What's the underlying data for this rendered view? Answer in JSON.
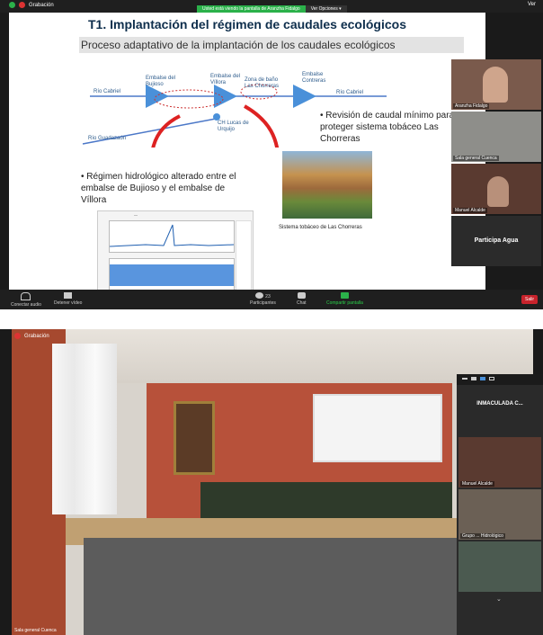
{
  "screenshot1": {
    "recording_label": "Grabación",
    "banner": {
      "sharing_text": "Usted está viendo la pantalla de Aranzha Fidalgo",
      "view_options": "Ver Opciones ▾"
    },
    "view_button": "Ver",
    "slide": {
      "title": "T1. Implantación del régimen de caudales ecológicos",
      "subtitle": "Proceso adaptativo de la implantación de los caudales ecológicos",
      "diagram_labels": {
        "rio_cabriel_left": "Río Cabriel",
        "embalse_bujioso": "Embalse del Bujioso",
        "embalse_villora": "Embalse del Víllora",
        "zona_bano": "Zona de baño Las Chorreras",
        "embalse_contreras": "Embalse Contreras",
        "rio_cabriel_right": "Río Cabriel",
        "rio_guadazaon": "Río Guadazaón",
        "ch_lucas": "CH Lucas de Urquijo"
      },
      "bullet_right": "Revisión de caudal mínimo para proteger sistema tobáceo Las Chorreras",
      "bullet_left": "Régimen hidrológico alterado entre el embalse de Bujioso y el embalse de Víllora",
      "photo_caption": "Sistema tobáceo de Las Chorreras"
    },
    "gallery": [
      {
        "name": "Aranzha Fidalgo"
      },
      {
        "name": "Sala general Cuenca"
      },
      {
        "name": "Manuel Alcalde"
      },
      {
        "big_name": "Participa Agua"
      }
    ],
    "bottombar": {
      "audio_label": "Conectar audio",
      "video_label": "Detener vídeo",
      "participants_label": "Participantes",
      "participants_count": "23",
      "chat_label": "Chat",
      "share_label": "Compartir pantalla",
      "exit_label": "Salir"
    }
  },
  "screenshot2": {
    "recording_label": "Grabación",
    "room_label": "Sala general Cuenca",
    "side_panel": {
      "featured_name": "INMACULADA C...",
      "tiles": [
        {
          "name": "Manuel Alcalde"
        },
        {
          "name": "Grupo ... Hidrológico"
        },
        {
          "name": ""
        }
      ]
    }
  }
}
